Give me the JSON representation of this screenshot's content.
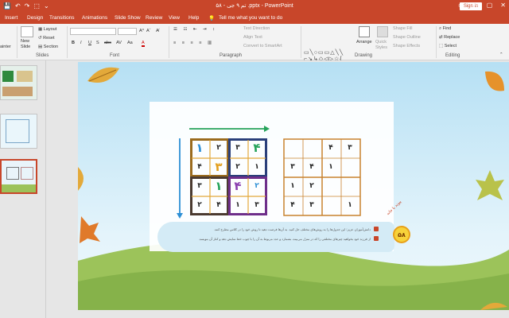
{
  "titlebar": {
    "title": "۵۸ - تم ۹ جی .pptx - PowerPoint",
    "signin": "Sign in",
    "qat": [
      "💾",
      "↶",
      "↷",
      "⬚",
      "⌄"
    ],
    "winbtns": [
      "▭",
      "—",
      "▢",
      "✕"
    ]
  },
  "tabs": [
    "Insert",
    "Design",
    "Transitions",
    "Animations",
    "Slide Show",
    "Review",
    "View",
    "Help",
    "Tell me what you want to do"
  ],
  "ribbon": {
    "clipboard": {
      "painter": "ainter"
    },
    "slides": {
      "new_slide": "New\nSlide",
      "layout": "Layout",
      "reset": "Reset",
      "section": "Section",
      "label": "Slides"
    },
    "font": {
      "bold": "B",
      "italic": "I",
      "underline": "U",
      "shadow": "S",
      "strike": "abc",
      "spacing": "AV",
      "case": "Aa",
      "color": "A",
      "grow": "A^",
      "shrink": "Aˇ",
      "clear": "A̸",
      "label": "Font"
    },
    "paragraph": {
      "text_direction": "Text Direction",
      "align_text": "Align Text",
      "smartart": "Convert to SmartArt",
      "label": "Paragraph"
    },
    "drawing": {
      "arrange": "Arrange",
      "quick_styles": "Quick\nStyles",
      "shape_fill": "Shape Fill",
      "shape_outline": "Shape Outline",
      "shape_effects": "Shape Effects",
      "label": "Drawing"
    },
    "editing": {
      "find": "Find",
      "replace": "Replace",
      "select": "Select",
      "label": "Editing"
    }
  },
  "thumbs": [
    {
      "num": ""
    },
    {
      "num": ""
    },
    {
      "num": ""
    }
  ],
  "slide": {
    "grid1": [
      [
        "۱",
        "۲",
        "۳",
        "۴"
      ],
      [
        "۴",
        "۳",
        "۲",
        "۱"
      ],
      [
        "۳",
        "۱",
        "۴",
        "۲"
      ],
      [
        "۲",
        "۴",
        "۱",
        "۳"
      ]
    ],
    "grid2": [
      [
        "",
        "",
        "۴",
        "۳"
      ],
      [
        "۳",
        "۴",
        "۱",
        ""
      ],
      [
        "۱",
        "۲",
        "",
        ""
      ],
      [
        "۴",
        "۳",
        "",
        "۱"
      ]
    ],
    "instruction_1": "دانش‌آموزان عزیز؛ این جدول‌ها را به روش‌های مختلف حل کنید. به آن‌ها فرصت دهید تا روش خود را در کلاس مطرح کنند.",
    "instruction_2": "از فرزند خود بخواهید چیزهای مختلفی را که در منزل می‌بیند، بشمارد و عدد مربوط به آن را با چوب خط نمایش دهد و کنار آن بنویسد.",
    "page_number": "۵۸",
    "ribbon_label": "پیوند با خانه"
  }
}
